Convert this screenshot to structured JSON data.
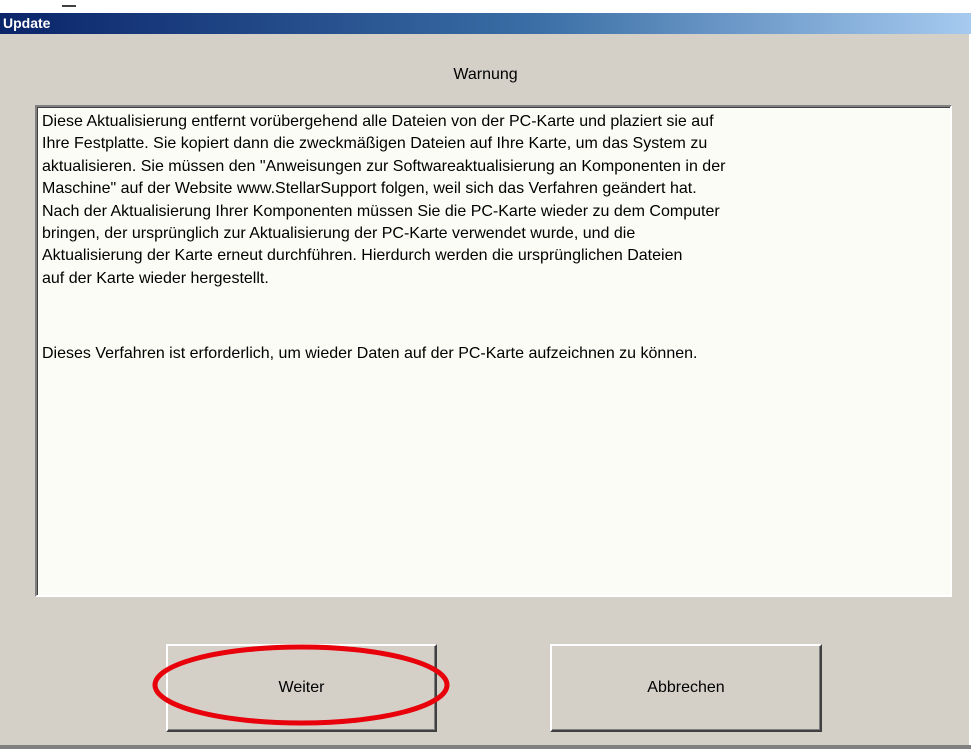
{
  "window": {
    "title": "Update"
  },
  "dialog": {
    "heading": "Warnung",
    "message_paragraph_1": "Diese Aktualisierung entfernt vorübergehend alle Dateien von der PC-Karte und plaziert sie auf\nIhre Festplatte. Sie kopiert dann die zweckmäßigen Dateien auf Ihre Karte, um das System zu\naktualisieren. Sie müssen den \"Anweisungen zur Softwareaktualisierung an Komponenten in der\nMaschine\" auf der Website www.StellarSupport folgen, weil sich das Verfahren geändert hat.\nNach der Aktualisierung Ihrer Komponenten müssen Sie die PC-Karte wieder zu dem Computer\nbringen, der ursprünglich zur Aktualisierung der PC-Karte verwendet wurde, und die\nAktualisierung der Karte erneut durchführen. Hierdurch werden die ursprünglichen Dateien\nauf der Karte wieder hergestellt.",
    "message_paragraph_2": "Dieses Verfahren ist erforderlich, um wieder Daten auf der PC-Karte aufzeichnen zu können.",
    "buttons": {
      "continue_label": "Weiter",
      "cancel_label": "Abbrechen"
    }
  },
  "colors": {
    "titlebar_start": "#0a246a",
    "titlebar_end": "#a6caf0",
    "dialog_background": "#d4d0c8",
    "text_area_background": "#fbfcf6",
    "highlight_circle": "#e8000b"
  }
}
